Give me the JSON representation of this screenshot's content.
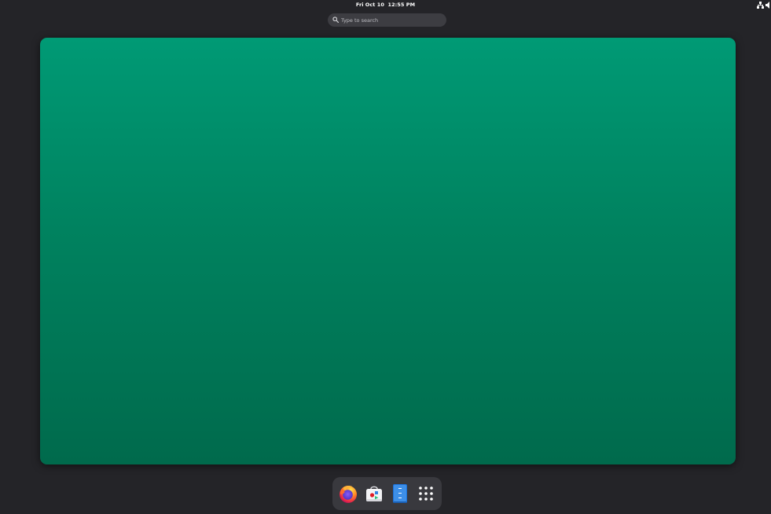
{
  "top_bar": {
    "clock": "Fri Oct 10  12:55 PM",
    "status_icons": [
      "network-wired-icon",
      "speaker-volume-icon"
    ]
  },
  "search": {
    "placeholder": "Type to search",
    "value": "",
    "icon": "search-icon"
  },
  "workspace": {
    "colors": {
      "top": "#009a75",
      "bottom": "#006a4c"
    }
  },
  "dash": {
    "items": [
      {
        "name": "Firefox",
        "icon": "firefox-icon"
      },
      {
        "name": "Software",
        "icon": "software-store-icon"
      },
      {
        "name": "Text Editor",
        "icon": "text-editor-icon"
      },
      {
        "name": "Show Apps",
        "icon": "app-grid-icon"
      }
    ]
  },
  "colors": {
    "background": "#242428",
    "search_bg": "#3d3d42",
    "dash_bg": "#39393e"
  }
}
